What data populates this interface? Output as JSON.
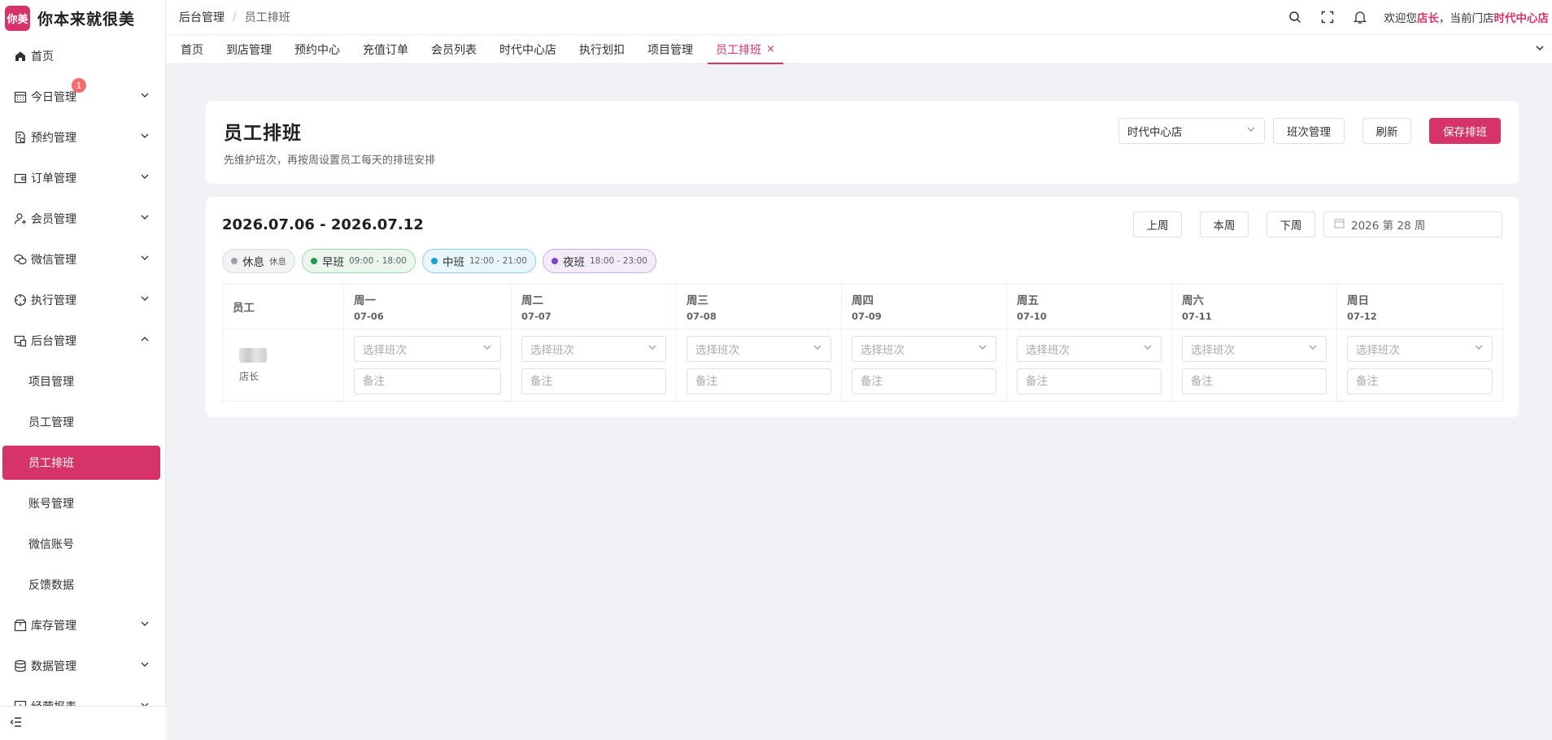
{
  "app": {
    "logo_badge": "你美",
    "name": "你本来就很美"
  },
  "sidebar": {
    "items": [
      {
        "label": "首页",
        "icon": "home-icon"
      },
      {
        "label": "今日管理",
        "icon": "calendar-icon",
        "badge": "1"
      },
      {
        "label": "预约管理",
        "icon": "booking-icon"
      },
      {
        "label": "订单管理",
        "icon": "wallet-icon"
      },
      {
        "label": "会员管理",
        "icon": "user-icon"
      },
      {
        "label": "微信管理",
        "icon": "wechat-icon"
      },
      {
        "label": "执行管理",
        "icon": "target-icon"
      },
      {
        "label": "后台管理",
        "icon": "monitor-icon"
      },
      {
        "label": "库存管理",
        "icon": "box-icon"
      },
      {
        "label": "数据管理",
        "icon": "database-icon"
      },
      {
        "label": "经营报表",
        "icon": "report-icon"
      }
    ],
    "sub_items": [
      "项目管理",
      "员工管理",
      "员工排班",
      "账号管理",
      "微信账号",
      "反馈数据"
    ],
    "active_sub": "员工排班"
  },
  "header": {
    "breadcrumb": [
      "后台管理",
      "员工排班"
    ],
    "breadcrumb_sep": "/",
    "welcome_prefix": "欢迎您",
    "user_role": "店长",
    "welcome_mid": "，当前门店",
    "current_store": "时代中心店"
  },
  "tabs": [
    {
      "label": "首页"
    },
    {
      "label": "到店管理"
    },
    {
      "label": "预约中心"
    },
    {
      "label": "充值订单"
    },
    {
      "label": "会员列表"
    },
    {
      "label": "时代中心店"
    },
    {
      "label": "执行划扣"
    },
    {
      "label": "项目管理"
    },
    {
      "label": "员工排班",
      "active": true,
      "close": "×"
    }
  ],
  "page": {
    "title": "员工排班",
    "subtitle": "先维护班次，再按周设置员工每天的排班安排",
    "store_select": "时代中心店",
    "btn_shift_manage": "班次管理",
    "btn_refresh": "刷新",
    "btn_save": "保存排班"
  },
  "schedule": {
    "range": "2026.07.06 - 2026.07.12",
    "btn_prev": "上周",
    "btn_this": "本周",
    "btn_next": "下周",
    "week_picker": "2026 第 28 周",
    "legend": [
      {
        "name": "休息",
        "time": "休息",
        "class": "rest",
        "color": "#9aa0a6"
      },
      {
        "name": "早班",
        "time": "09:00 - 18:00",
        "class": "early",
        "color": "#1e9e4a"
      },
      {
        "name": "中班",
        "time": "12:00 - 21:00",
        "class": "mid",
        "color": "#1a9fd6"
      },
      {
        "name": "夜班",
        "time": "18:00 - 23:00",
        "class": "night",
        "color": "#7c3fd1"
      }
    ],
    "employee_header": "员工",
    "days": [
      {
        "day": "周一",
        "date": "07-06"
      },
      {
        "day": "周二",
        "date": "07-07"
      },
      {
        "day": "周三",
        "date": "07-08"
      },
      {
        "day": "周四",
        "date": "07-09"
      },
      {
        "day": "周五",
        "date": "07-10"
      },
      {
        "day": "周六",
        "date": "07-11"
      },
      {
        "day": "周日",
        "date": "07-12"
      }
    ],
    "employee_role": "店长",
    "select_placeholder": "选择班次",
    "note_placeholder": "备注"
  },
  "colors": {
    "accent": "#d63469",
    "badge": "#f56c6c"
  }
}
